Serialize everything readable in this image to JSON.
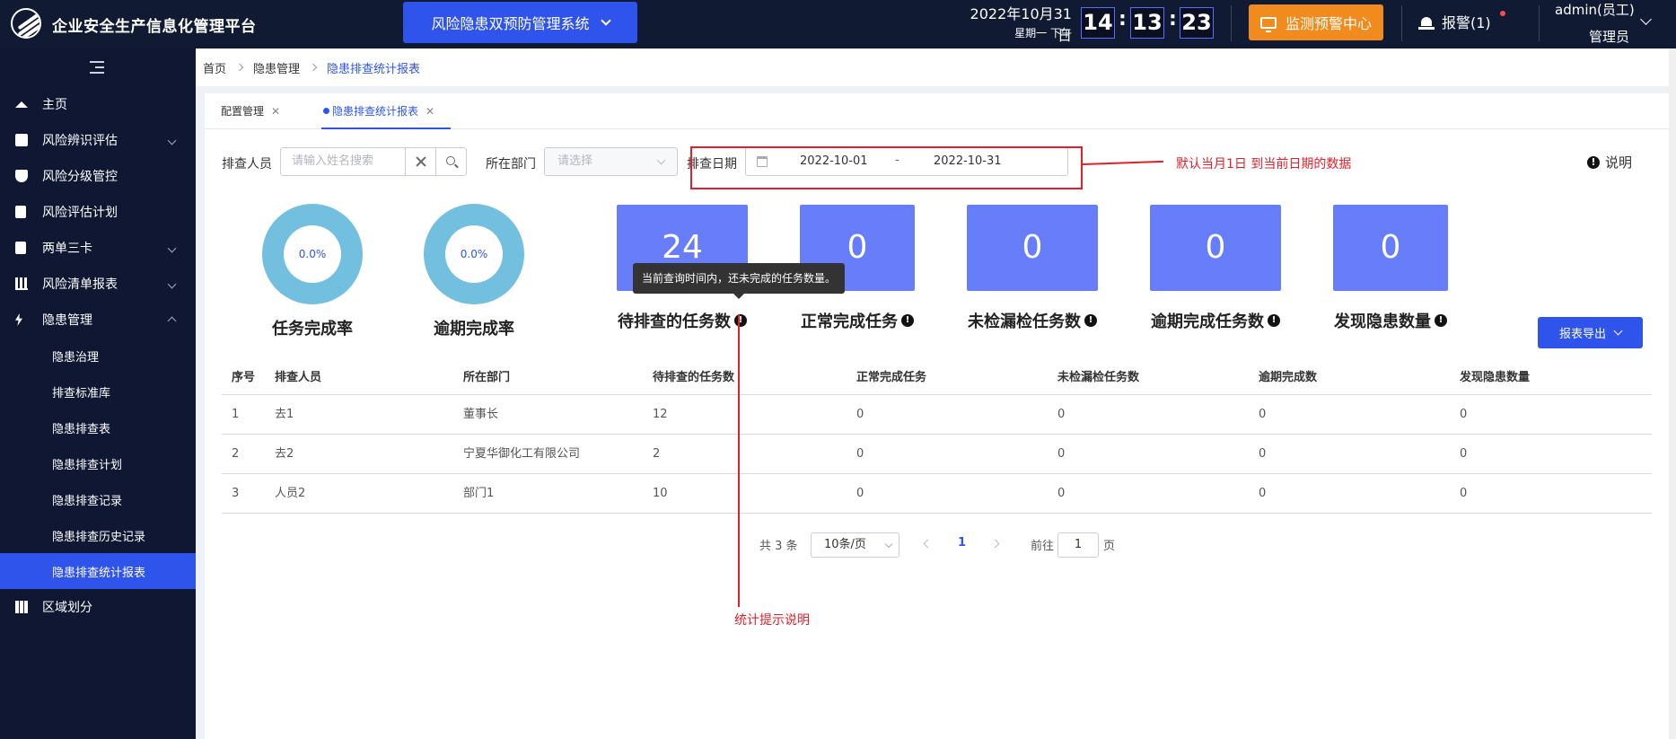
{
  "header": {
    "title": "企业安全生产信息化管理平台",
    "system": "风险隐患双预防管理系统",
    "date": "2022年10月31日",
    "weekday": "星期一  下午",
    "clock": {
      "h": "14",
      "m": "13",
      "s": "23"
    },
    "monitor_label": "监测预警中心",
    "alarm_label": "报警(1)",
    "user_name": "admin(员工)",
    "user_role": "管理员"
  },
  "sidebar": {
    "items": [
      {
        "label": "主页",
        "icon": "home-icon"
      },
      {
        "label": "风险辨识评估",
        "icon": "edit-icon"
      },
      {
        "label": "风险分级管控",
        "icon": "shield-icon"
      },
      {
        "label": "风险评估计划",
        "icon": "document-icon"
      },
      {
        "label": "两单三卡",
        "icon": "clipboard-icon"
      },
      {
        "label": "风险清单报表",
        "icon": "bar-chart-icon"
      },
      {
        "label": "隐患管理",
        "icon": "lightning-icon"
      },
      {
        "label": "区域划分",
        "icon": "grid-icon"
      }
    ],
    "subitems": [
      "隐患治理",
      "排查标准库",
      "隐患排查表",
      "隐患排查计划",
      "隐患排查记录",
      "隐患排查历史记录",
      "隐患排查统计报表"
    ]
  },
  "breadcrumb": [
    "首页",
    "隐患管理",
    "隐患排查统计报表"
  ],
  "tabs": [
    {
      "label": "配置管理"
    },
    {
      "label": "隐患排查统计报表"
    }
  ],
  "filters": {
    "person_label": "排查人员",
    "person_placeholder": "请输入姓名搜索",
    "dept_label": "所在部门",
    "dept_placeholder": "请选择",
    "date_label": "排查日期",
    "date_start": "2022-10-01",
    "date_sep": "-",
    "date_end": "2022-10-31"
  },
  "annotations": {
    "date_note": "默认当月1日 到当前日期的数据",
    "stat_note": "统计提示说明"
  },
  "help_label": "说明",
  "donuts": [
    {
      "value": "0.0%",
      "label": "任务完成率"
    },
    {
      "value": "0.0%",
      "label": "逾期完成率"
    }
  ],
  "stats": [
    {
      "value": "24",
      "label": "待排查的任务数"
    },
    {
      "value": "0",
      "label": "正常完成任务"
    },
    {
      "value": "0",
      "label": "未检漏检任务数"
    },
    {
      "value": "0",
      "label": "逾期完成任务数"
    },
    {
      "value": "0",
      "label": "发现隐患数量"
    }
  ],
  "tooltip": "当前查询时间内，还未完成的任务数量。",
  "export_label": "报表导出",
  "table": {
    "columns": [
      "序号",
      "排查人员",
      "所在部门",
      "待排查的任务数",
      "正常完成任务",
      "未检漏检任务数",
      "逾期完成数",
      "发现隐患数量"
    ],
    "rows": [
      [
        "1",
        "去1",
        "董事长",
        "12",
        "0",
        "0",
        "0",
        "0"
      ],
      [
        "2",
        "去2",
        "宁夏华御化工有限公司",
        "2",
        "0",
        "0",
        "0",
        "0"
      ],
      [
        "3",
        "人员2",
        "部门1",
        "10",
        "0",
        "0",
        "0",
        "0"
      ]
    ]
  },
  "pager": {
    "total": "共 3 条",
    "page_size": "10条/页",
    "current": "1",
    "goto_label": "前往",
    "goto_value": "1",
    "page_suffix": "页"
  },
  "colors": {
    "accent": "#2f54eb",
    "stat_box": "#687dfa",
    "donut": "#72bfe0",
    "annotation": "#e0202a",
    "header_bg": "#111a33"
  }
}
